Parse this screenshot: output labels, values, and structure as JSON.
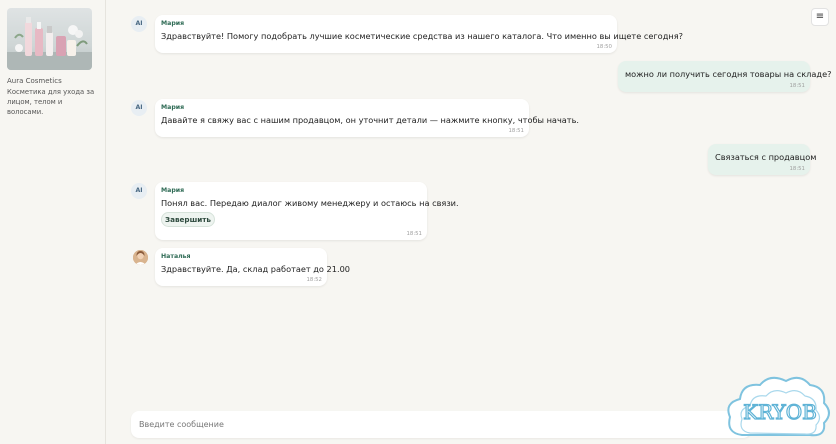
{
  "sidebar": {
    "shop_name": "Aura Cosmetics",
    "shop_description": "Косметика для ухода за лицом, телом и волосами."
  },
  "header": {
    "menu_icon": "≡"
  },
  "messages": [
    {
      "sender": "Мария",
      "avatar": "AI",
      "text": "Здравствуйте! Помогу подобрать лучшие косметические средства из нашего каталога. Что именно вы ищете сегодня?",
      "time": "18:50"
    },
    {
      "text": "можно ли получить сегодня товары на складе?",
      "time": "18:51"
    },
    {
      "sender": "Мария",
      "avatar": "AI",
      "text": "Давайте я свяжу вас с нашим продавцом, он уточнит детали — нажмите кнопку, чтобы начать.",
      "time": "18:51"
    },
    {
      "text": "Связаться с продавцом",
      "time": "18:51"
    },
    {
      "sender": "Мария",
      "avatar": "AI",
      "text": "Понял вас. Передаю диалог живому менеджеру и остаюсь на связи.",
      "button": "Завершить",
      "time": "18:51"
    },
    {
      "sender": "Наталья",
      "text": "Здравствуйте. Да, склад работает до 21.00",
      "time": "18:52"
    }
  ],
  "composer": {
    "placeholder": "Введите сообщение"
  },
  "watermark": {
    "text": "KRYOB"
  },
  "colors": {
    "background": "#f7f6f2",
    "user_bubble": "#e6f2ec",
    "sender_name": "#2f6b55"
  }
}
